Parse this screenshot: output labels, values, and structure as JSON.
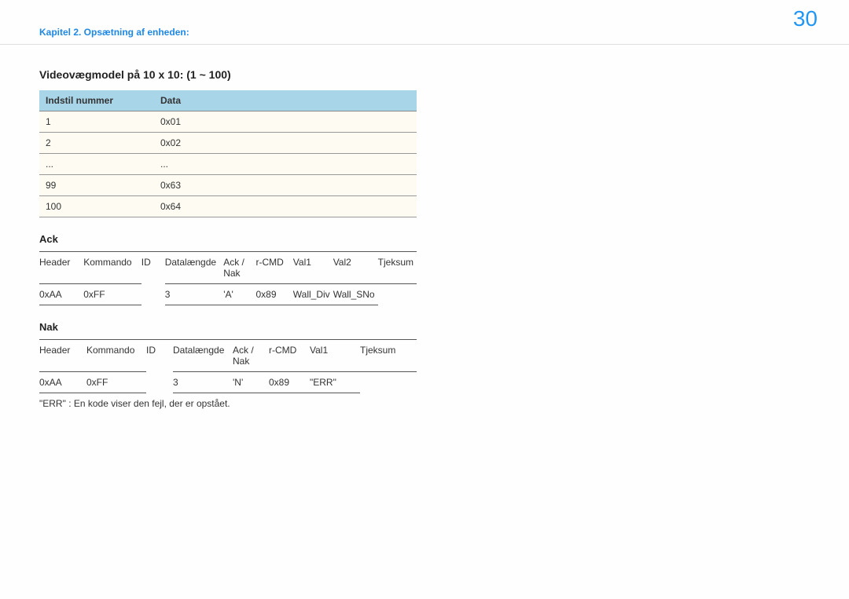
{
  "header": {
    "breadcrumb": "Kapitel 2. Opsætning af enheden:",
    "page_number": "30"
  },
  "section": {
    "title": "Videovægmodel på 10 x 10: (1 ~ 100)",
    "map_headers": {
      "num": "Indstil nummer",
      "data": "Data"
    },
    "map_rows": [
      {
        "num": "1",
        "data": "0x01"
      },
      {
        "num": "2",
        "data": "0x02"
      },
      {
        "num": "...",
        "data": "..."
      },
      {
        "num": "99",
        "data": "0x63"
      },
      {
        "num": "100",
        "data": "0x64"
      }
    ],
    "ack": {
      "title": "Ack",
      "headers": [
        "Header",
        "Kommando",
        "ID",
        "Datalængde",
        "Ack / Nak",
        "r-CMD",
        "Val1",
        "Val2",
        "Tjeksum"
      ],
      "row": [
        "0xAA",
        "0xFF",
        "",
        "3",
        "'A'",
        "0x89",
        "Wall_Div",
        "Wall_SNo",
        ""
      ]
    },
    "nak": {
      "title": "Nak",
      "headers": [
        "Header",
        "Kommando",
        "ID",
        "Datalængde",
        "Ack / Nak",
        "r-CMD",
        "Val1",
        "Tjeksum"
      ],
      "row": [
        "0xAA",
        "0xFF",
        "",
        "3",
        "'N'",
        "0x89",
        "\"ERR\"",
        ""
      ]
    },
    "footnote": "\"ERR\" : En kode viser den fejl, der er opstået."
  }
}
